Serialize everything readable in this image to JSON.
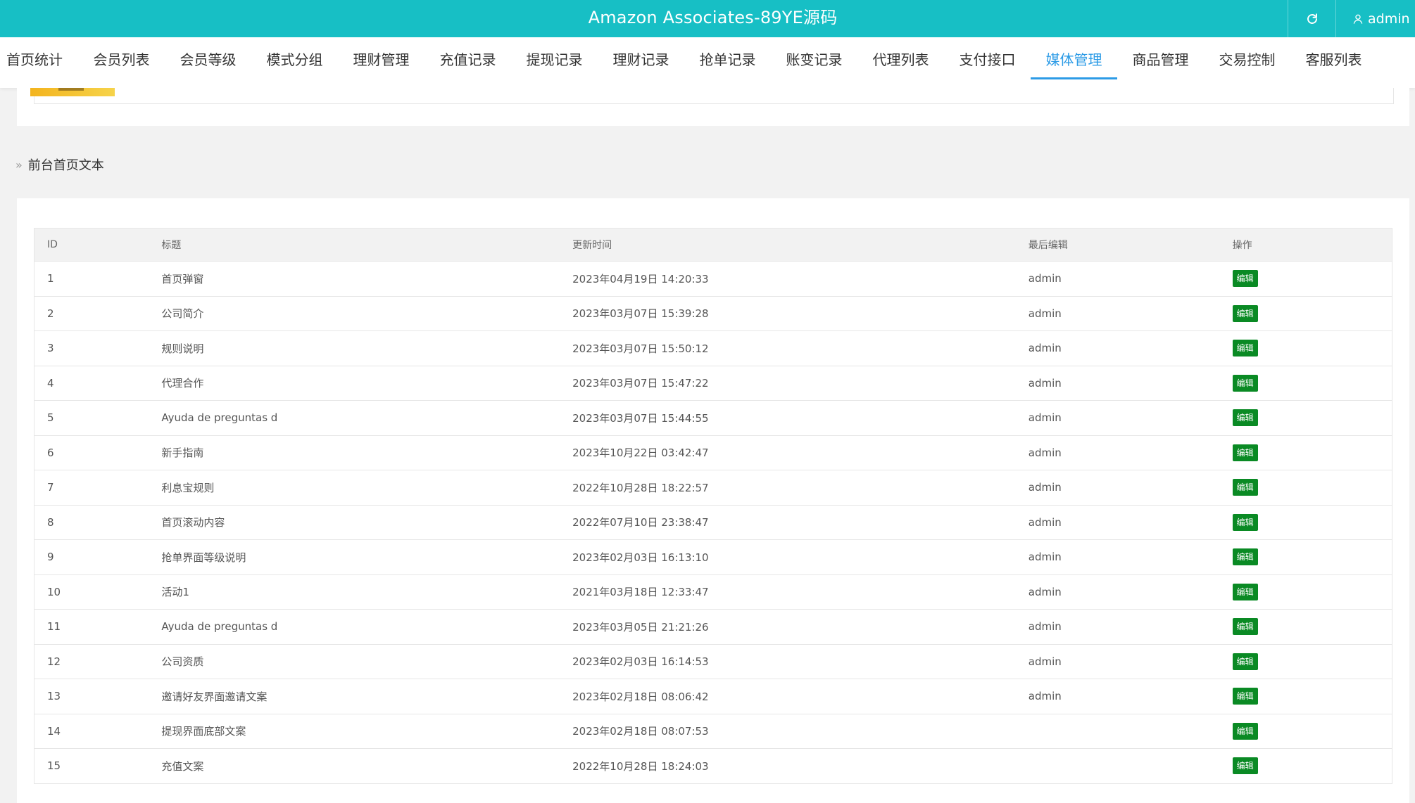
{
  "header": {
    "title": "Amazon Associates-89YE源码",
    "user": "admin",
    "background": "#17bfc5"
  },
  "nav": {
    "tabs": [
      {
        "label": "首页统计"
      },
      {
        "label": "会员列表"
      },
      {
        "label": "会员等级"
      },
      {
        "label": "模式分组"
      },
      {
        "label": "理财管理"
      },
      {
        "label": "充值记录"
      },
      {
        "label": "提现记录"
      },
      {
        "label": "理财记录"
      },
      {
        "label": "抢单记录"
      },
      {
        "label": "账变记录"
      },
      {
        "label": "代理列表"
      },
      {
        "label": "支付接口"
      },
      {
        "label": "媒体管理",
        "active": true
      },
      {
        "label": "商品管理"
      },
      {
        "label": "交易控制"
      },
      {
        "label": "客服列表"
      }
    ],
    "active_color": "#2c9be6"
  },
  "section": {
    "title": "前台首页文本"
  },
  "table": {
    "columns": {
      "id": "ID",
      "title": "标题",
      "updated": "更新时间",
      "editor": "最后编辑",
      "action": "操作"
    },
    "action_label": "编辑",
    "action_color": "#0a8a24",
    "rows": [
      {
        "id": "1",
        "title": "首页弹窗",
        "updated": "2023年04月19日 14:20:33",
        "editor": "admin"
      },
      {
        "id": "2",
        "title": "公司简介",
        "updated": "2023年03月07日 15:39:28",
        "editor": "admin"
      },
      {
        "id": "3",
        "title": "规则说明",
        "updated": "2023年03月07日 15:50:12",
        "editor": "admin"
      },
      {
        "id": "4",
        "title": "代理合作",
        "updated": "2023年03月07日 15:47:22",
        "editor": "admin"
      },
      {
        "id": "5",
        "title": "Ayuda de preguntas d",
        "updated": "2023年03月07日 15:44:55",
        "editor": "admin"
      },
      {
        "id": "6",
        "title": "新手指南",
        "updated": "2023年10月22日 03:42:47",
        "editor": "admin"
      },
      {
        "id": "7",
        "title": "利息宝规则",
        "updated": "2022年10月28日 18:22:57",
        "editor": "admin"
      },
      {
        "id": "8",
        "title": "首页滚动内容",
        "updated": "2022年07月10日 23:38:47",
        "editor": "admin"
      },
      {
        "id": "9",
        "title": "抢单界面等级说明",
        "updated": "2023年02月03日 16:13:10",
        "editor": "admin"
      },
      {
        "id": "10",
        "title": "活动1",
        "updated": "2021年03月18日 12:33:47",
        "editor": "admin"
      },
      {
        "id": "11",
        "title": "Ayuda de preguntas d",
        "updated": "2023年03月05日 21:21:26",
        "editor": "admin"
      },
      {
        "id": "12",
        "title": "公司资质",
        "updated": "2023年02月03日 16:14:53",
        "editor": "admin"
      },
      {
        "id": "13",
        "title": "邀请好友界面邀请文案",
        "updated": "2023年02月18日 08:06:42",
        "editor": "admin"
      },
      {
        "id": "14",
        "title": "提现界面底部文案",
        "updated": "2023年02月18日 08:07:53",
        "editor": ""
      },
      {
        "id": "15",
        "title": "充值文案",
        "updated": "2022年10月28日 18:24:03",
        "editor": ""
      }
    ]
  }
}
